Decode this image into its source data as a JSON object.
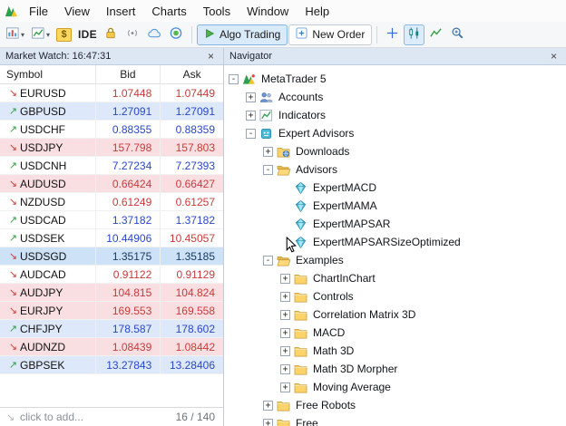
{
  "menu": {
    "items": [
      "File",
      "View",
      "Insert",
      "Charts",
      "Tools",
      "Window",
      "Help"
    ]
  },
  "toolbar": {
    "ide_label": "IDE",
    "algo_trading_label": "Algo Trading",
    "new_order_label": "New Order",
    "caret": "▾",
    "icons": [
      "mt5-logo",
      "new-chart",
      "chart-profiles",
      "market-watch-dollar",
      "ide",
      "lock",
      "signal",
      "cloud",
      "community",
      "algo-trading-play",
      "new-order-plus",
      "crosshair",
      "candlesticks",
      "line-chart",
      "zoom-in"
    ]
  },
  "window_controls": {
    "close": "×"
  },
  "market_watch": {
    "title": "Market Watch: 16:47:31",
    "columns": [
      "Symbol",
      "Bid",
      "Ask"
    ],
    "up_arrow": "↗",
    "down_arrow": "↘",
    "rows": [
      {
        "symbol": "EURUSD",
        "bid": "1.07448",
        "ask": "1.07449",
        "dir": "down",
        "bg": "none",
        "bid_color": "red",
        "ask_color": "red"
      },
      {
        "symbol": "GBPUSD",
        "bid": "1.27091",
        "ask": "1.27091",
        "dir": "up",
        "bg": "blue",
        "bid_color": "blue",
        "ask_color": "blue"
      },
      {
        "symbol": "USDCHF",
        "bid": "0.88355",
        "ask": "0.88359",
        "dir": "up",
        "bg": "none",
        "bid_color": "blue",
        "ask_color": "blue"
      },
      {
        "symbol": "USDJPY",
        "bid": "157.798",
        "ask": "157.803",
        "dir": "down",
        "bg": "pink",
        "bid_color": "red",
        "ask_color": "red"
      },
      {
        "symbol": "USDCNH",
        "bid": "7.27234",
        "ask": "7.27393",
        "dir": "up",
        "bg": "none",
        "bid_color": "blue",
        "ask_color": "blue"
      },
      {
        "symbol": "AUDUSD",
        "bid": "0.66424",
        "ask": "0.66427",
        "dir": "down",
        "bg": "pink",
        "bid_color": "red",
        "ask_color": "red"
      },
      {
        "symbol": "NZDUSD",
        "bid": "0.61249",
        "ask": "0.61257",
        "dir": "down",
        "bg": "none",
        "bid_color": "red",
        "ask_color": "red"
      },
      {
        "symbol": "USDCAD",
        "bid": "1.37182",
        "ask": "1.37182",
        "dir": "up",
        "bg": "none",
        "bid_color": "blue",
        "ask_color": "blue"
      },
      {
        "symbol": "USDSEK",
        "bid": "10.44906",
        "ask": "10.45057",
        "dir": "up",
        "bg": "none",
        "bid_color": "blue",
        "ask_color": "red"
      },
      {
        "symbol": "USDSGD",
        "bid": "1.35175",
        "ask": "1.35185",
        "dir": "down",
        "bg": "sel",
        "bid_color": "dark",
        "ask_color": "dark"
      },
      {
        "symbol": "AUDCAD",
        "bid": "0.91122",
        "ask": "0.91129",
        "dir": "down",
        "bg": "none",
        "bid_color": "red",
        "ask_color": "red"
      },
      {
        "symbol": "AUDJPY",
        "bid": "104.815",
        "ask": "104.824",
        "dir": "down",
        "bg": "pink",
        "bid_color": "red",
        "ask_color": "red"
      },
      {
        "symbol": "EURJPY",
        "bid": "169.553",
        "ask": "169.558",
        "dir": "down",
        "bg": "pink",
        "bid_color": "red",
        "ask_color": "red"
      },
      {
        "symbol": "CHFJPY",
        "bid": "178.587",
        "ask": "178.602",
        "dir": "up",
        "bg": "blue",
        "bid_color": "blue",
        "ask_color": "blue"
      },
      {
        "symbol": "AUDNZD",
        "bid": "1.08439",
        "ask": "1.08442",
        "dir": "down",
        "bg": "pink",
        "bid_color": "red",
        "ask_color": "red"
      },
      {
        "symbol": "GBPSEK",
        "bid": "13.27843",
        "ask": "13.28406",
        "dir": "up",
        "bg": "blue",
        "bid_color": "blue",
        "ask_color": "blue"
      }
    ],
    "footer_left": "click to add...",
    "footer_right": "16 / 140"
  },
  "navigator": {
    "title": "Navigator",
    "tree": [
      {
        "label": "MetaTrader 5",
        "level": 0,
        "expander": "minus",
        "icon": "mt5"
      },
      {
        "label": "Accounts",
        "level": 1,
        "expander": "plus",
        "icon": "accounts"
      },
      {
        "label": "Indicators",
        "level": 1,
        "expander": "plus",
        "icon": "indicators"
      },
      {
        "label": "Expert Advisors",
        "level": 1,
        "expander": "minus",
        "icon": "experts"
      },
      {
        "label": "Downloads",
        "level": 2,
        "expander": "plus",
        "icon": "downloads"
      },
      {
        "label": "Advisors",
        "level": 2,
        "expander": "minus",
        "icon": "folder-open"
      },
      {
        "label": "ExpertMACD",
        "level": 3,
        "expander": "none",
        "icon": "expert"
      },
      {
        "label": "ExpertMAMA",
        "level": 3,
        "expander": "none",
        "icon": "expert"
      },
      {
        "label": "ExpertMAPSAR",
        "level": 3,
        "expander": "none",
        "icon": "expert"
      },
      {
        "label": "ExpertMAPSARSizeOptimized",
        "level": 3,
        "expander": "none",
        "icon": "expert"
      },
      {
        "label": "Examples",
        "level": 2,
        "expander": "minus",
        "icon": "folder-open"
      },
      {
        "label": "ChartInChart",
        "level": 3,
        "expander": "plus",
        "icon": "folder"
      },
      {
        "label": "Controls",
        "level": 3,
        "expander": "plus",
        "icon": "folder"
      },
      {
        "label": "Correlation Matrix 3D",
        "level": 3,
        "expander": "plus",
        "icon": "folder"
      },
      {
        "label": "MACD",
        "level": 3,
        "expander": "plus",
        "icon": "folder"
      },
      {
        "label": "Math 3D",
        "level": 3,
        "expander": "plus",
        "icon": "folder"
      },
      {
        "label": "Math 3D Morpher",
        "level": 3,
        "expander": "plus",
        "icon": "folder"
      },
      {
        "label": "Moving Average",
        "level": 3,
        "expander": "plus",
        "icon": "folder"
      },
      {
        "label": "Free Robots",
        "level": 2,
        "expander": "plus",
        "icon": "folder"
      },
      {
        "label": "Free",
        "level": 2,
        "expander": "plus",
        "icon": "folder"
      }
    ]
  }
}
